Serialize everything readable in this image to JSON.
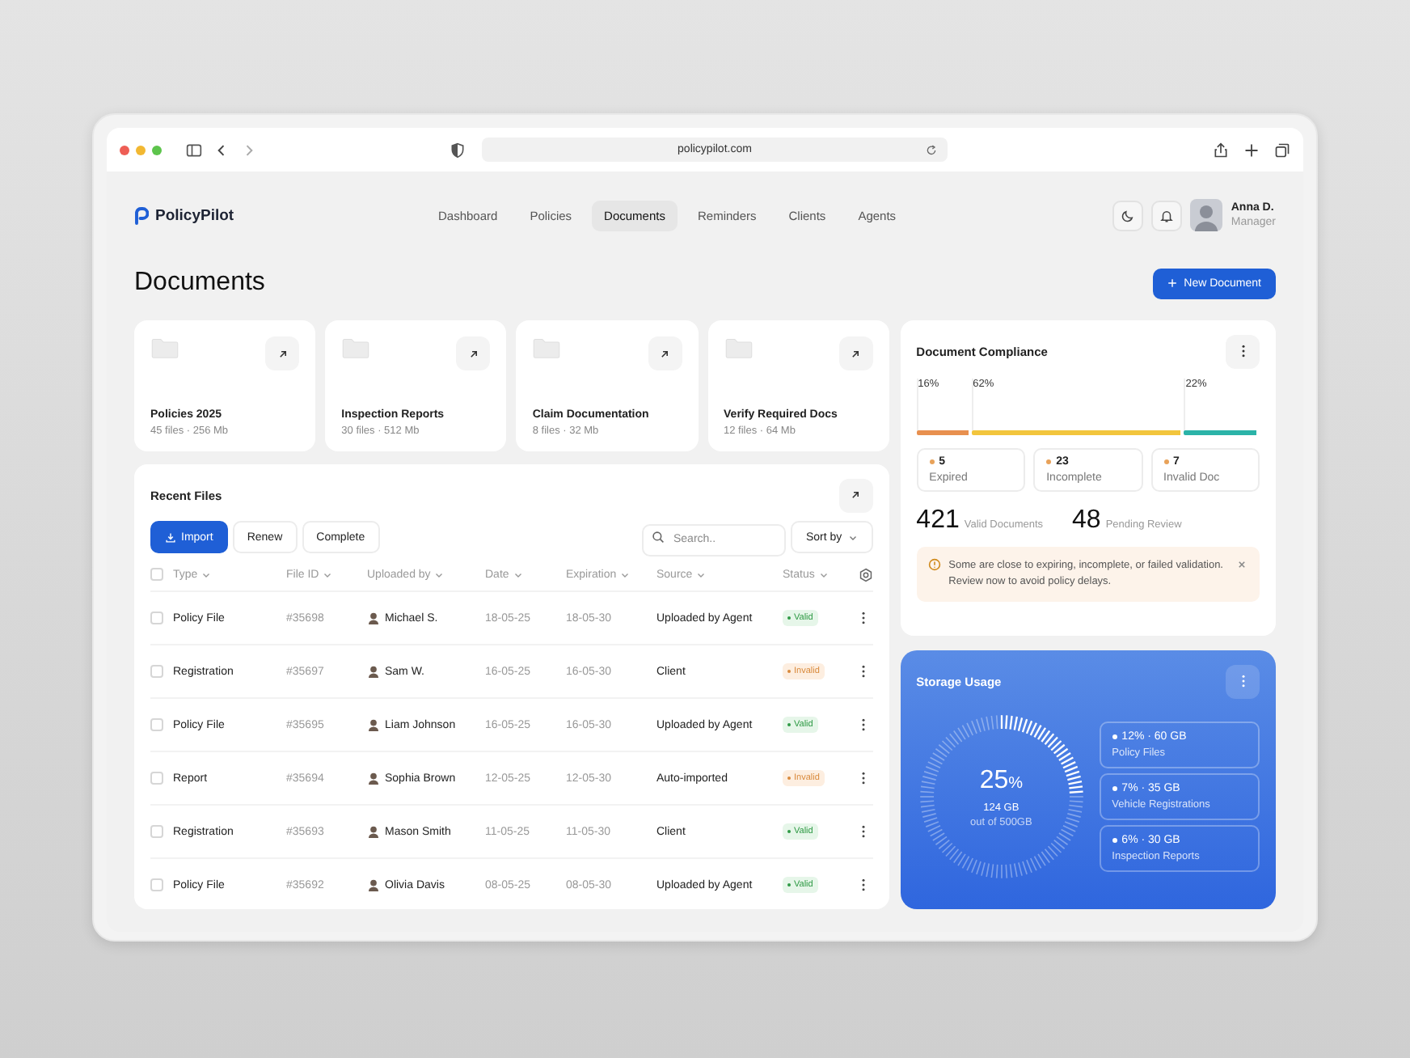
{
  "browser": {
    "url": "policypilot.com"
  },
  "app": {
    "logo": "PolicyPilot",
    "nav": [
      {
        "label": "Dashboard",
        "selected": false
      },
      {
        "label": "Policies",
        "selected": false
      },
      {
        "label": "Documents",
        "selected": true
      },
      {
        "label": "Reminders",
        "selected": false
      },
      {
        "label": "Clients",
        "selected": false
      },
      {
        "label": "Agents",
        "selected": false
      }
    ],
    "user": {
      "name": "Anna D.",
      "role": "Manager"
    }
  },
  "page_title": "Documents",
  "new_button": "New Document",
  "folders": [
    {
      "name": "Policies 2025",
      "meta": "45 files · 256 Mb"
    },
    {
      "name": "Inspection Reports",
      "meta": "30 files · 512 Mb"
    },
    {
      "name": "Claim Documentation",
      "meta": "8 files · 32 Mb"
    },
    {
      "name": "Verify Required Docs",
      "meta": "12 files · 64 Mb"
    }
  ],
  "recent_files": {
    "title": "Recent Files",
    "import_button": "Import",
    "buttons": [
      "Renew",
      "Complete"
    ],
    "search": {
      "placeholder": "Search.."
    },
    "sort": "Sort by",
    "select_all_checked": false,
    "columns": [
      "Type",
      "File ID",
      "Uploaded by",
      "Date",
      "Expiration",
      "Source",
      "Status"
    ],
    "rows": [
      {
        "checked": false,
        "type": "Policy File",
        "id": "#35698",
        "uploader": "Michael S.",
        "date": "18-05-25",
        "expiration": "18-05-30",
        "source": "Uploaded by Agent",
        "status": {
          "label": "Valid",
          "kind": "valid"
        }
      },
      {
        "checked": false,
        "type": "Registration",
        "id": "#35697",
        "uploader": "Sam W.",
        "date": "16-05-25",
        "expiration": "16-05-30",
        "source": "Client",
        "status": {
          "label": "Invalid",
          "kind": "invalid"
        }
      },
      {
        "checked": false,
        "type": "Policy File",
        "id": "#35695",
        "uploader": "Liam Johnson",
        "date": "16-05-25",
        "expiration": "16-05-30",
        "source": "Uploaded by Agent",
        "status": {
          "label": "Valid",
          "kind": "valid"
        }
      },
      {
        "checked": false,
        "type": "Report",
        "id": "#35694",
        "uploader": "Sophia Brown",
        "date": "12-05-25",
        "expiration": "12-05-30",
        "source": "Auto-imported",
        "status": {
          "label": "Invalid",
          "kind": "invalid"
        }
      },
      {
        "checked": false,
        "type": "Registration",
        "id": "#35693",
        "uploader": "Mason Smith",
        "date": "11-05-25",
        "expiration": "11-05-30",
        "source": "Client",
        "status": {
          "label": "Valid",
          "kind": "valid"
        }
      },
      {
        "checked": false,
        "type": "Policy File",
        "id": "#35692",
        "uploader": "Olivia Davis",
        "date": "08-05-25",
        "expiration": "08-05-30",
        "source": "Uploaded by Agent",
        "status": {
          "label": "Valid",
          "kind": "valid"
        }
      }
    ]
  },
  "compliance": {
    "title": "Document Compliance",
    "segments": [
      {
        "label": "16%",
        "color": "#e8904f"
      },
      {
        "label": "62%",
        "color": "#f2c53d"
      },
      {
        "label": "22%",
        "color": "#2bb3a8"
      }
    ],
    "stats": [
      {
        "count": "5",
        "label": "Expired"
      },
      {
        "count": "23",
        "label": "Incomplete"
      },
      {
        "count": "7",
        "label": "Invalid Doc"
      }
    ],
    "totals": [
      {
        "value": "421",
        "label": "Valid Documents"
      },
      {
        "value": "48",
        "label": "Pending Review"
      }
    ],
    "alert": "Some are close to expiring, incomplete, or failed validation. Review now to avoid policy delays."
  },
  "storage": {
    "title": "Storage Usage",
    "percent": "25",
    "unit": "%",
    "used": "124 GB",
    "total": "out of 500GB",
    "breakdown": [
      {
        "value": "12% · 60 GB",
        "label": "Policy Files"
      },
      {
        "value": "7% · 35 GB",
        "label": "Vehicle Registrations"
      },
      {
        "value": "6% · 30 GB",
        "label": "Inspection Reports"
      }
    ]
  }
}
